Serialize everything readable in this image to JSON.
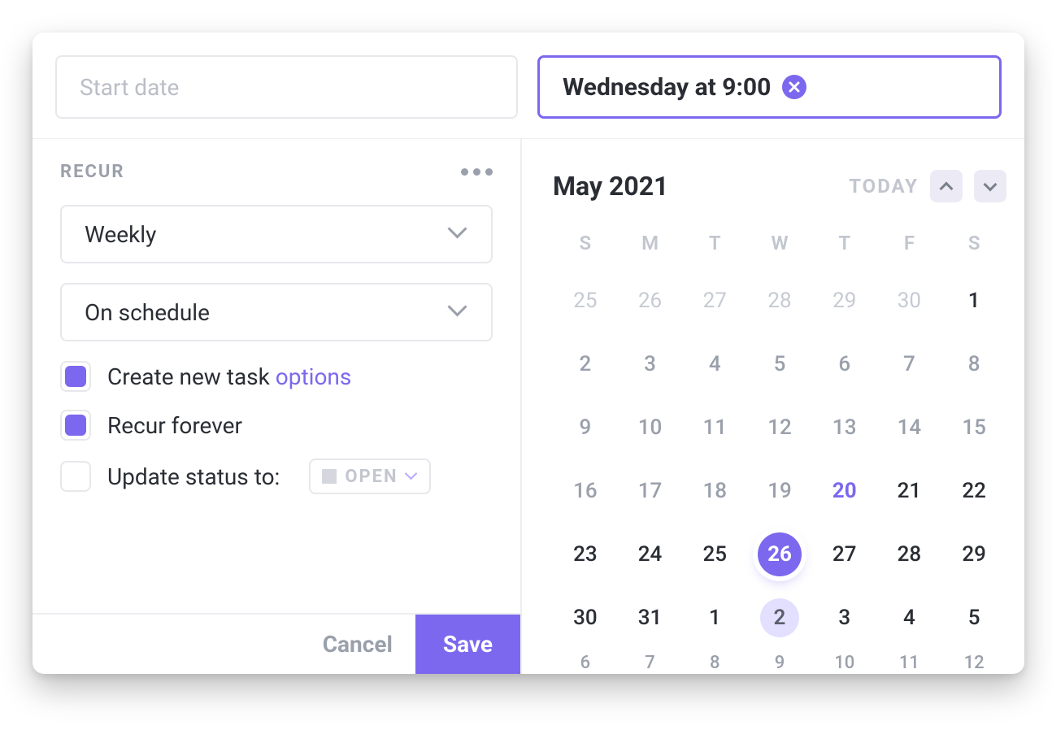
{
  "inputs": {
    "start_date_placeholder": "Start date",
    "due_value": "Wednesday at 9:00"
  },
  "recur": {
    "title": "RECUR",
    "frequency": "Weekly",
    "trigger": "On schedule",
    "create_new_task": "Create new task",
    "options_link": "options",
    "recur_forever": "Recur forever",
    "update_status": "Update status to:",
    "status_value": "OPEN"
  },
  "footer": {
    "cancel": "Cancel",
    "save": "Save"
  },
  "calendar": {
    "month_label": "May 2021",
    "today_button": "TODAY",
    "dow": [
      "S",
      "M",
      "T",
      "W",
      "T",
      "F",
      "S"
    ],
    "weeks": [
      [
        {
          "n": 25,
          "adjacent": true
        },
        {
          "n": 26,
          "adjacent": true
        },
        {
          "n": 27,
          "adjacent": true
        },
        {
          "n": 28,
          "adjacent": true
        },
        {
          "n": 29,
          "adjacent": true
        },
        {
          "n": 30,
          "adjacent": true
        },
        {
          "n": 1
        }
      ],
      [
        {
          "n": 2,
          "dim": true
        },
        {
          "n": 3,
          "dim": true
        },
        {
          "n": 4,
          "dim": true
        },
        {
          "n": 5,
          "dim": true
        },
        {
          "n": 6,
          "dim": true
        },
        {
          "n": 7,
          "dim": true
        },
        {
          "n": 8,
          "dim": true
        }
      ],
      [
        {
          "n": 9,
          "dim": true
        },
        {
          "n": 10,
          "dim": true
        },
        {
          "n": 11,
          "dim": true
        },
        {
          "n": 12,
          "dim": true
        },
        {
          "n": 13,
          "dim": true
        },
        {
          "n": 14,
          "dim": true
        },
        {
          "n": 15,
          "dim": true
        }
      ],
      [
        {
          "n": 16,
          "dim": true
        },
        {
          "n": 17,
          "dim": true
        },
        {
          "n": 18,
          "dim": true
        },
        {
          "n": 19,
          "dim": true
        },
        {
          "n": 20,
          "today": true
        },
        {
          "n": 21
        },
        {
          "n": 22
        }
      ],
      [
        {
          "n": 23
        },
        {
          "n": 24
        },
        {
          "n": 25
        },
        {
          "n": 26,
          "selected": true
        },
        {
          "n": 27
        },
        {
          "n": 28
        },
        {
          "n": 29
        }
      ],
      [
        {
          "n": 30
        },
        {
          "n": 31
        },
        {
          "n": 1,
          "adjacent": false
        },
        {
          "n": 2,
          "nextSel": true
        },
        {
          "n": 3
        },
        {
          "n": 4
        },
        {
          "n": 5
        }
      ],
      [
        {
          "n": 6,
          "cut": true
        },
        {
          "n": 7,
          "cut": true
        },
        {
          "n": 8,
          "cut": true
        },
        {
          "n": 9,
          "cut": true
        },
        {
          "n": 10,
          "cut": true
        },
        {
          "n": 11,
          "cut": true
        },
        {
          "n": 12,
          "cut": true
        }
      ]
    ]
  }
}
